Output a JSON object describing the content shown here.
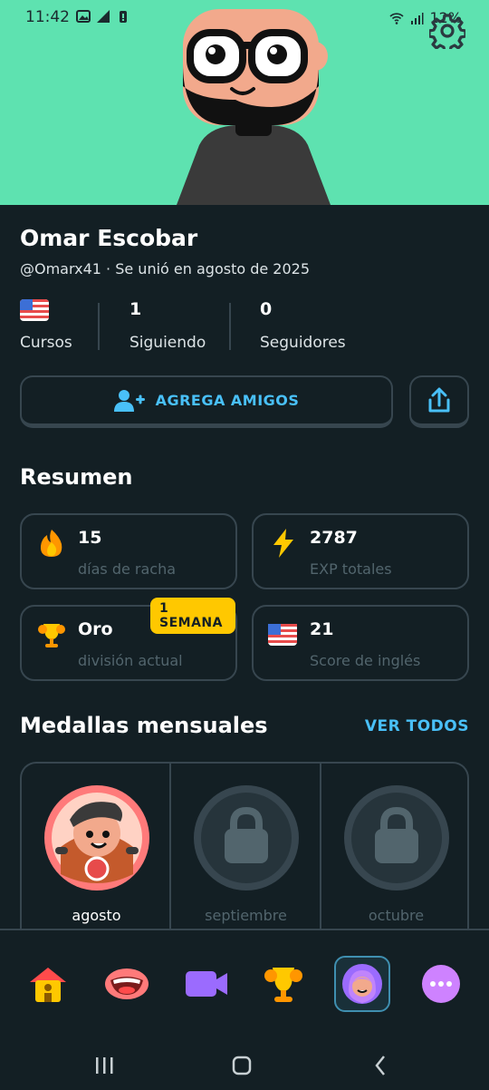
{
  "status_bar": {
    "time": "11:42",
    "battery": "12%"
  },
  "profile": {
    "name": "Omar Escobar",
    "handle_line": "@Omarx41 · Se unió en agosto de 2025",
    "stats": [
      {
        "value": "",
        "label": "Cursos",
        "icon": "us-flag-icon"
      },
      {
        "value": "1",
        "label": "Siguiendo"
      },
      {
        "value": "0",
        "label": "Seguidores"
      }
    ],
    "add_friends_label": "AGREGA AMIGOS"
  },
  "summary": {
    "title": "Resumen",
    "cards": [
      {
        "value": "15",
        "label": "días de racha",
        "icon": "fire-icon"
      },
      {
        "value": "2787",
        "label": "EXP totales",
        "icon": "lightning-icon"
      },
      {
        "value": "Oro",
        "label": "división actual",
        "icon": "trophy-icon",
        "badge": "1 SEMANA"
      },
      {
        "value": "21",
        "label": "Score de inglés",
        "icon": "us-flag-icon"
      }
    ]
  },
  "monthly_badges": {
    "title": "Medallas mensuales",
    "see_all": "VER TODOS",
    "items": [
      {
        "label": "agosto",
        "unlocked": true
      },
      {
        "label": "septiembre",
        "unlocked": false
      },
      {
        "label": "octubre",
        "unlocked": false
      }
    ]
  },
  "bottom_nav": [
    {
      "name": "home",
      "icon": "home-icon"
    },
    {
      "name": "speak",
      "icon": "mouth-icon"
    },
    {
      "name": "video",
      "icon": "video-icon"
    },
    {
      "name": "leaderboard",
      "icon": "trophy-icon"
    },
    {
      "name": "profile",
      "icon": "avatar-icon",
      "active": true
    },
    {
      "name": "more",
      "icon": "more-icon"
    }
  ],
  "colors": {
    "background": "#131f24",
    "header": "#5ee2b0",
    "accent_blue": "#49c0f8",
    "border": "#37464f",
    "gold": "#ffc800"
  }
}
